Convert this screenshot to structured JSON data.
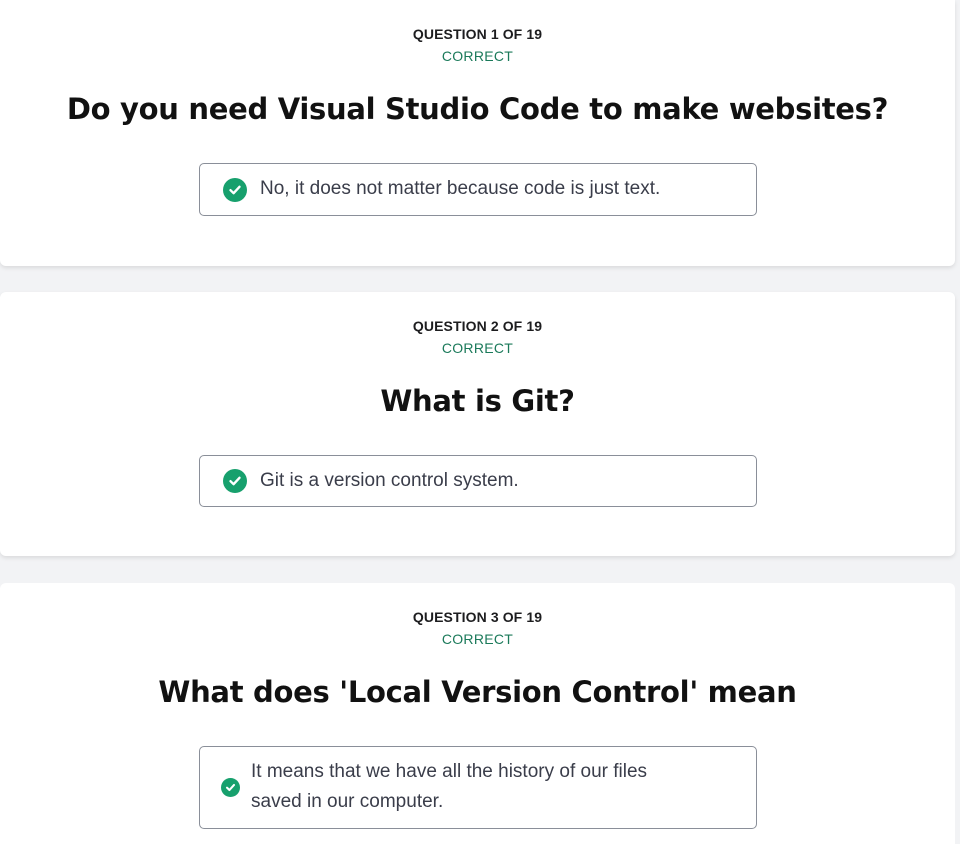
{
  "questions": [
    {
      "number_label": "QUESTION 1 OF 19",
      "status": "CORRECT",
      "question": "Do you need Visual Studio Code to make websites?",
      "answer": "No, it does not matter because code is just text.",
      "answer_icon": "check-circle-icon"
    },
    {
      "number_label": "QUESTION 2 OF 19",
      "status": "CORRECT",
      "question": "What is Git?",
      "answer": "Git is a version control system.",
      "answer_icon": "check-circle-icon"
    },
    {
      "number_label": "QUESTION 3 OF 19",
      "status": "CORRECT",
      "question": "What does 'Local Version Control' mean",
      "answer_lines": [
        "It means that we have all the history of our files",
        "saved in our computer."
      ],
      "answer_icon": "check-circle-icon"
    }
  ],
  "colors": {
    "correct": "#1b7a5a",
    "check_fill": "#17a06d",
    "page_bg": "#f2f3f5"
  }
}
